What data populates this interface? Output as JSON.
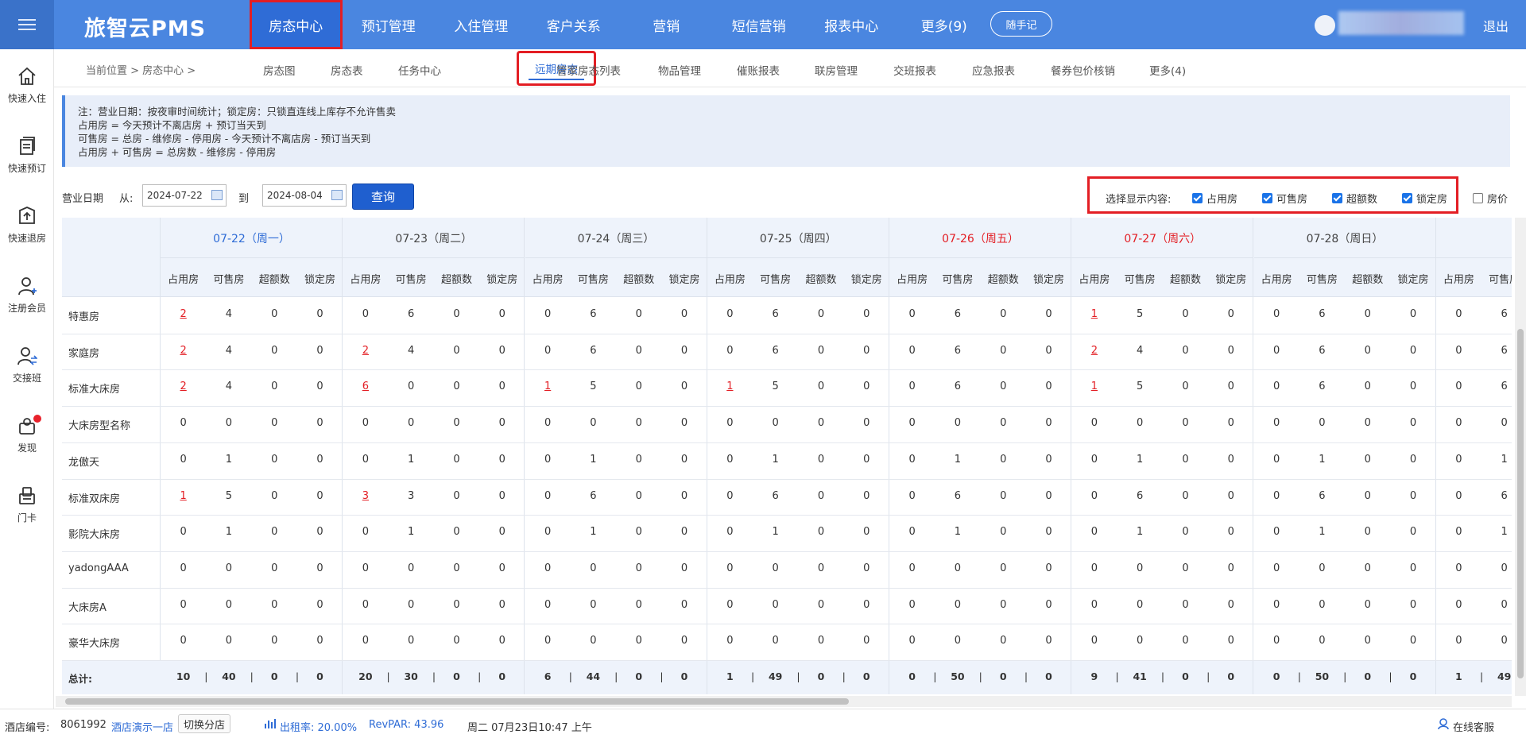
{
  "app": {
    "brand": "旅智云PMS"
  },
  "nav": {
    "items": [
      "房态中心",
      "预订管理",
      "入住管理",
      "客户关系",
      "营销",
      "短信营销",
      "报表中心",
      "更多(9)"
    ],
    "quick_note": "随手记",
    "logout": "退出"
  },
  "sidebar": {
    "items": [
      {
        "label": "快速入住",
        "icon": "home-icon"
      },
      {
        "label": "快速预订",
        "icon": "booking-icon"
      },
      {
        "label": "快速退房",
        "icon": "checkout-icon"
      },
      {
        "label": "注册会员",
        "icon": "add-member-icon"
      },
      {
        "label": "交接班",
        "icon": "shift-handover-icon"
      },
      {
        "label": "发现",
        "icon": "discover-icon"
      },
      {
        "label": "门卡",
        "icon": "door-card-icon"
      }
    ]
  },
  "breadcrumb": "当前位置 > 房态中心 >",
  "subtabs": [
    "房态图",
    "房态表",
    "任务中心",
    "远期房态",
    "管家房态列表",
    "物品管理",
    "催账报表",
    "联房管理",
    "交班报表",
    "应急报表",
    "餐券包价核销",
    "更多(4)"
  ],
  "notice": [
    "注：营业日期：按夜审时间统计；锁定房：只锁直连线上库存不允许售卖",
    "占用房 = 今天预计不离店房 + 预订当天到",
    "可售房 = 总房 - 维修房 - 停用房 - 今天预计不离店房 - 预订当天到",
    "占用房 + 可售房 = 总房数 - 维修房 - 停用房"
  ],
  "query": {
    "label": "营业日期",
    "from_label": "从:",
    "from": "2024-07-22",
    "to_label": "到",
    "to": "2024-08-04",
    "button": "查询"
  },
  "display_options": {
    "label": "选择显示内容:",
    "options": [
      {
        "label": "占用房",
        "checked": true
      },
      {
        "label": "可售房",
        "checked": true
      },
      {
        "label": "超额数",
        "checked": true
      },
      {
        "label": "锁定房",
        "checked": true
      },
      {
        "label": "房价",
        "checked": false
      }
    ]
  },
  "table": {
    "columns": [
      "占用房",
      "可售房",
      "超额数",
      "锁定房"
    ],
    "days": [
      {
        "label": "07-22（周一）",
        "color": "#2f6cd6"
      },
      {
        "label": "07-23（周二）",
        "color": "#444444"
      },
      {
        "label": "07-24（周三）",
        "color": "#444444"
      },
      {
        "label": "07-25（周四）",
        "color": "#444444"
      },
      {
        "label": "07-26（周五）",
        "color": "#e31e24"
      },
      {
        "label": "07-27（周六）",
        "color": "#e31e24"
      },
      {
        "label": "07-28（周日）",
        "color": "#444444"
      },
      {
        "label": "07-2",
        "color": "#444444"
      }
    ],
    "rows": [
      {
        "room": "特惠房",
        "values": [
          [
            2,
            4,
            0,
            0
          ],
          [
            0,
            6,
            0,
            0
          ],
          [
            0,
            6,
            0,
            0
          ],
          [
            0,
            6,
            0,
            0
          ],
          [
            0,
            6,
            0,
            0
          ],
          [
            1,
            5,
            0,
            0
          ],
          [
            0,
            6,
            0,
            0
          ],
          [
            0,
            6
          ]
        ]
      },
      {
        "room": "家庭房",
        "values": [
          [
            2,
            4,
            0,
            0
          ],
          [
            2,
            4,
            0,
            0
          ],
          [
            0,
            6,
            0,
            0
          ],
          [
            0,
            6,
            0,
            0
          ],
          [
            0,
            6,
            0,
            0
          ],
          [
            2,
            4,
            0,
            0
          ],
          [
            0,
            6,
            0,
            0
          ],
          [
            0,
            6
          ]
        ]
      },
      {
        "room": "标准大床房",
        "values": [
          [
            2,
            4,
            0,
            0
          ],
          [
            6,
            0,
            0,
            0
          ],
          [
            1,
            5,
            0,
            0
          ],
          [
            1,
            5,
            0,
            0
          ],
          [
            0,
            6,
            0,
            0
          ],
          [
            1,
            5,
            0,
            0
          ],
          [
            0,
            6,
            0,
            0
          ],
          [
            0,
            6
          ]
        ]
      },
      {
        "room": "大床房型名称",
        "values": [
          [
            0,
            0,
            0,
            0
          ],
          [
            0,
            0,
            0,
            0
          ],
          [
            0,
            0,
            0,
            0
          ],
          [
            0,
            0,
            0,
            0
          ],
          [
            0,
            0,
            0,
            0
          ],
          [
            0,
            0,
            0,
            0
          ],
          [
            0,
            0,
            0,
            0
          ],
          [
            0,
            0
          ]
        ]
      },
      {
        "room": "龙傲天",
        "values": [
          [
            0,
            1,
            0,
            0
          ],
          [
            0,
            1,
            0,
            0
          ],
          [
            0,
            1,
            0,
            0
          ],
          [
            0,
            1,
            0,
            0
          ],
          [
            0,
            1,
            0,
            0
          ],
          [
            0,
            1,
            0,
            0
          ],
          [
            0,
            1,
            0,
            0
          ],
          [
            0,
            1
          ]
        ]
      },
      {
        "room": "标准双床房",
        "values": [
          [
            1,
            5,
            0,
            0
          ],
          [
            3,
            3,
            0,
            0
          ],
          [
            0,
            6,
            0,
            0
          ],
          [
            0,
            6,
            0,
            0
          ],
          [
            0,
            6,
            0,
            0
          ],
          [
            0,
            6,
            0,
            0
          ],
          [
            0,
            6,
            0,
            0
          ],
          [
            0,
            6
          ]
        ]
      },
      {
        "room": "影院大床房",
        "values": [
          [
            0,
            1,
            0,
            0
          ],
          [
            0,
            1,
            0,
            0
          ],
          [
            0,
            1,
            0,
            0
          ],
          [
            0,
            1,
            0,
            0
          ],
          [
            0,
            1,
            0,
            0
          ],
          [
            0,
            1,
            0,
            0
          ],
          [
            0,
            1,
            0,
            0
          ],
          [
            0,
            1
          ]
        ]
      },
      {
        "room": "yadongAAA",
        "values": [
          [
            0,
            0,
            0,
            0
          ],
          [
            0,
            0,
            0,
            0
          ],
          [
            0,
            0,
            0,
            0
          ],
          [
            0,
            0,
            0,
            0
          ],
          [
            0,
            0,
            0,
            0
          ],
          [
            0,
            0,
            0,
            0
          ],
          [
            0,
            0,
            0,
            0
          ],
          [
            0,
            0
          ]
        ]
      },
      {
        "room": "大床房A",
        "values": [
          [
            0,
            0,
            0,
            0
          ],
          [
            0,
            0,
            0,
            0
          ],
          [
            0,
            0,
            0,
            0
          ],
          [
            0,
            0,
            0,
            0
          ],
          [
            0,
            0,
            0,
            0
          ],
          [
            0,
            0,
            0,
            0
          ],
          [
            0,
            0,
            0,
            0
          ],
          [
            0,
            0
          ]
        ]
      },
      {
        "room": "豪华大床房",
        "values": [
          [
            0,
            0,
            0,
            0
          ],
          [
            0,
            0,
            0,
            0
          ],
          [
            0,
            0,
            0,
            0
          ],
          [
            0,
            0,
            0,
            0
          ],
          [
            0,
            0,
            0,
            0
          ],
          [
            0,
            0,
            0,
            0
          ],
          [
            0,
            0,
            0,
            0
          ],
          [
            0,
            0
          ]
        ]
      }
    ],
    "total_label": "总计:",
    "totals": [
      [
        10,
        40,
        0,
        0
      ],
      [
        20,
        30,
        0,
        0
      ],
      [
        6,
        44,
        0,
        0
      ],
      [
        1,
        49,
        0,
        0
      ],
      [
        0,
        50,
        0,
        0
      ],
      [
        9,
        41,
        0,
        0
      ],
      [
        0,
        50,
        0,
        0
      ],
      [
        1,
        49
      ]
    ]
  },
  "statusbar": {
    "hotel_label": "酒店编号:",
    "hotel_id": "8061992",
    "hotel_name": "酒店演示一店",
    "switch_button": "切换分店",
    "occupancy": "出租率: 20.00%",
    "revpar": "RevPAR: 43.96",
    "datetime": "周二 07月23日10:47 上午",
    "support": "在线客服"
  }
}
